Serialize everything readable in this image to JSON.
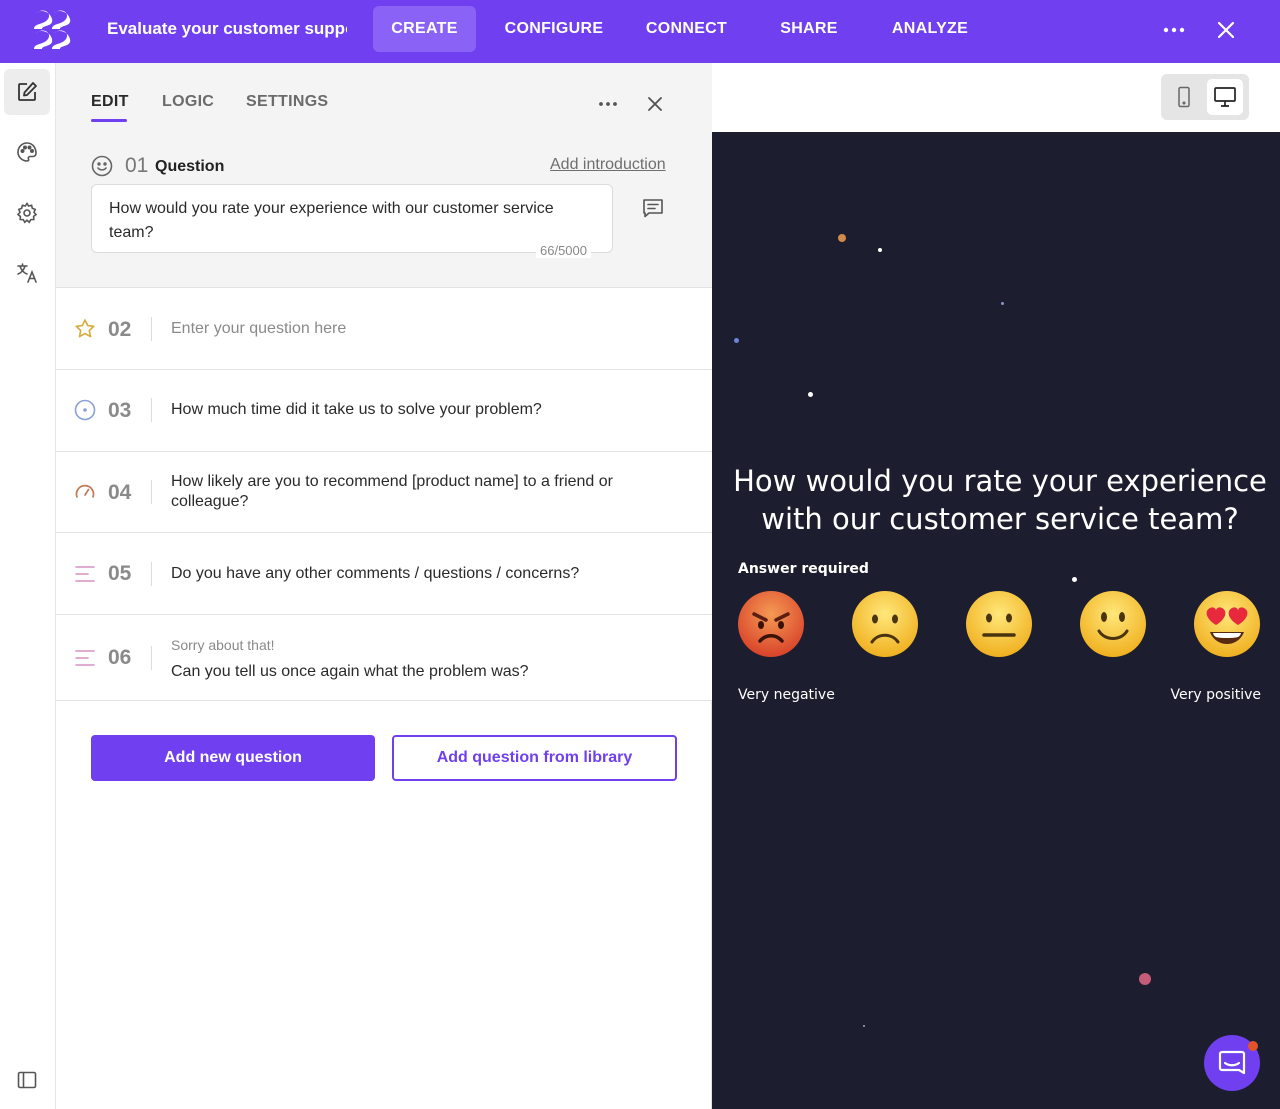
{
  "topbar": {
    "title": "Evaluate your customer suppo",
    "tabs": [
      {
        "label": "CREATE",
        "active": true
      },
      {
        "label": "CONFIGURE",
        "active": false
      },
      {
        "label": "CONNECT",
        "active": false
      },
      {
        "label": "SHARE",
        "active": false
      },
      {
        "label": "ANALYZE",
        "active": false
      }
    ],
    "more_icon": "more-horizontal-icon",
    "close_icon": "close-icon",
    "accent_color": "#6f3ff0"
  },
  "rail": {
    "items": [
      {
        "icon": "edit-icon",
        "active": true
      },
      {
        "icon": "palette-icon",
        "active": false
      },
      {
        "icon": "gear-icon",
        "active": false
      },
      {
        "icon": "translate-icon",
        "active": false
      }
    ],
    "bottom_icon": "sidebar-toggle-icon"
  },
  "editor": {
    "tabs": [
      {
        "label": "EDIT",
        "active": true
      },
      {
        "label": "LOGIC",
        "active": false
      },
      {
        "label": "SETTINGS",
        "active": false
      }
    ],
    "question1": {
      "number": "01",
      "type_label": "Question",
      "add_intro": "Add introduction",
      "text": "How would you rate your experience with our customer service team?",
      "char_count": "66/5000"
    },
    "questions": [
      {
        "number": "02",
        "icon": "star-icon",
        "text": "Enter your question here",
        "placeholder": true
      },
      {
        "number": "03",
        "icon": "radio-icon",
        "text": "How much time did it take us to solve your problem?"
      },
      {
        "number": "04",
        "icon": "gauge-icon",
        "text": "How likely are you to recommend [product name] to a friend or colleague?"
      },
      {
        "number": "05",
        "icon": "text-lines-icon",
        "text": "Do you have any other comments / questions / concerns?"
      },
      {
        "number": "06",
        "icon": "text-lines-icon",
        "intro": "Sorry about that!",
        "text": "Can you tell us once again what the problem was?"
      }
    ],
    "add_new_label": "Add new question",
    "add_library_label": "Add question from library"
  },
  "preview": {
    "question": "How would you rate your experience with our customer service team?",
    "required_label": "Answer required",
    "low_label": "Very negative",
    "high_label": "Very positive",
    "scale": [
      "angry",
      "sad",
      "neutral",
      "smile",
      "love"
    ],
    "background_color": "#1c1e2f"
  }
}
